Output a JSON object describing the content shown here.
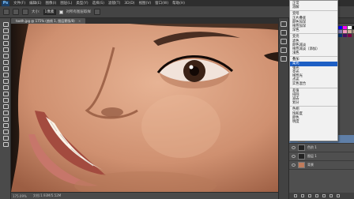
{
  "app": {
    "logo": "Ps"
  },
  "menubar": {
    "items": [
      "文件(F)",
      "编辑(E)",
      "图像(I)",
      "图层(L)",
      "类型(Y)",
      "选择(S)",
      "滤镜(T)",
      "3D(D)",
      "视图(V)",
      "窗口(W)",
      "帮助(H)"
    ]
  },
  "options": {
    "label1": "大小:",
    "value1": "1像素",
    "check_label": "对所有图层取样"
  },
  "document_tab": {
    "label": "tooth.jpg @ 175% (曲线 1, 图层蒙版/8)",
    "close": "×"
  },
  "status": {
    "zoom": "175.09%",
    "doc": "文档:1.93M/5.52M"
  },
  "menu": {
    "groups": [
      [
        "正常",
        "溶解"
      ],
      [
        "变暗",
        "正片叠底",
        "颜色加深",
        "线性加深",
        "深色"
      ],
      [
        "变亮",
        "滤色",
        "颜色减淡",
        "线性减淡（添加）",
        "浅色"
      ],
      [
        "叠加",
        "柔光",
        "强光",
        "亮光",
        "线性光",
        "点光",
        "实色混合"
      ],
      [
        "差值",
        "排除",
        "减去",
        "划分"
      ],
      [
        "色相",
        "饱和度",
        "颜色",
        "明度"
      ]
    ],
    "selected": "柔光"
  },
  "layers": {
    "rows": [
      "曲线 1",
      "色阶 1",
      "图层 1",
      "背景"
    ]
  },
  "colors": {
    "accent": "#1e5fc4",
    "skin": "#c8906e"
  }
}
